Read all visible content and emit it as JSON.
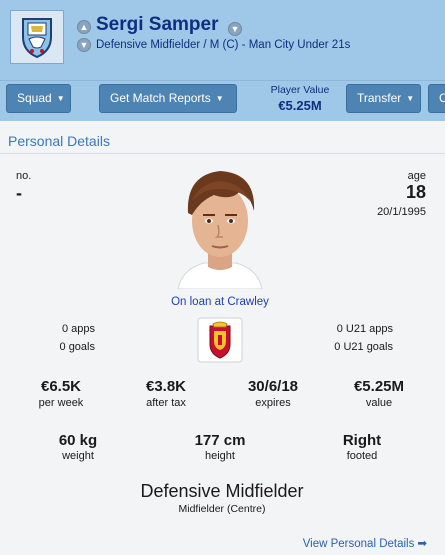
{
  "player": {
    "name": "Sergi Samper",
    "role_line": "Defensive Midfielder / M (C) - Man City Under 21s"
  },
  "toolbar": {
    "squad_label": "Squad",
    "reports_label": "Get Match Reports",
    "player_value_label": "Player Value",
    "player_value": "€5.25M",
    "transfer_label": "Transfer",
    "cut_label": "C"
  },
  "personal": {
    "section_title": "Personal Details",
    "no_label": "no.",
    "no_value": "-",
    "age_label": "age",
    "age_value": "18",
    "dob": "20/1/1995",
    "loan_text": "On loan at Crawley",
    "apps": "0 apps",
    "goals": "0 goals",
    "u21_apps": "0 U21 apps",
    "u21_goals": "0 U21 goals",
    "contract": [
      {
        "value": "€6.5K",
        "label": "per week"
      },
      {
        "value": "€3.8K",
        "label": "after tax"
      },
      {
        "value": "30/6/18",
        "label": "expires"
      },
      {
        "value": "€5.25M",
        "label": "value"
      }
    ],
    "physical": [
      {
        "value": "60 kg",
        "label": "weight"
      },
      {
        "value": "177 cm",
        "label": "height"
      },
      {
        "value": "Right",
        "label": "footed"
      }
    ],
    "position_main": "Defensive Midfielder",
    "position_sub": "Midfielder (Centre)",
    "view_link": "View Personal Details"
  },
  "colors": {
    "header_bg": "#9fc8e8",
    "button_bg": "#4d84b4",
    "name_text": "#0d2f80",
    "link": "#2a62b0",
    "panel_bg": "#f3f4f6"
  },
  "icons": {
    "club_badge": "man-city-badge-icon",
    "nation_flag": "spain-crest-icon",
    "dropdown": "chevron-down-icon",
    "arrow": "arrow-right-icon"
  }
}
